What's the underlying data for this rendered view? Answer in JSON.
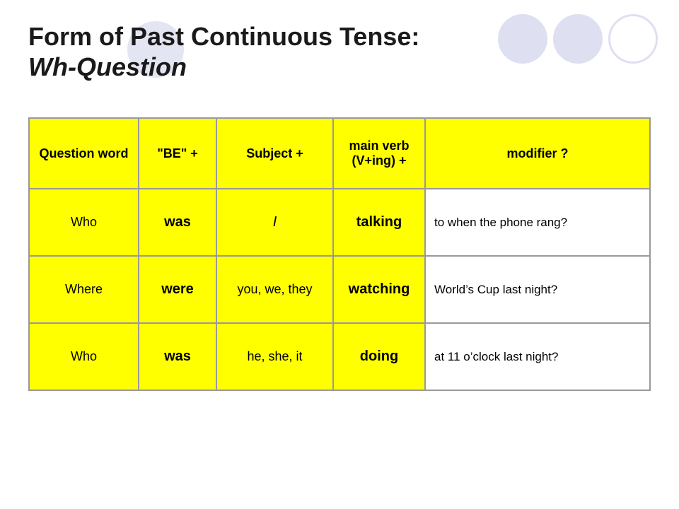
{
  "title": {
    "line1": "Form of Past Continuous Tense:",
    "line2": "Wh-Question"
  },
  "table": {
    "headers": [
      "Question word",
      "“BE” +",
      "Subject +",
      "main verb (V+ing) +",
      "modifier ?"
    ],
    "rows": [
      {
        "question_word": "Who",
        "be": "was",
        "subject": "I",
        "subject_italic": true,
        "main_verb": "talking",
        "modifier": "to when the phone rang?"
      },
      {
        "question_word": "Where",
        "be": "were",
        "subject": "you, we, they",
        "subject_italic": false,
        "main_verb": "watching",
        "modifier": "World’s Cup last night?"
      },
      {
        "question_word": "Who",
        "be": "was",
        "subject": "he, she, it",
        "subject_italic": false,
        "main_verb": "doing",
        "modifier": "at 11 o’clock last night?"
      }
    ]
  },
  "decorative": {
    "circles": [
      "filled",
      "filled",
      "outline"
    ]
  }
}
